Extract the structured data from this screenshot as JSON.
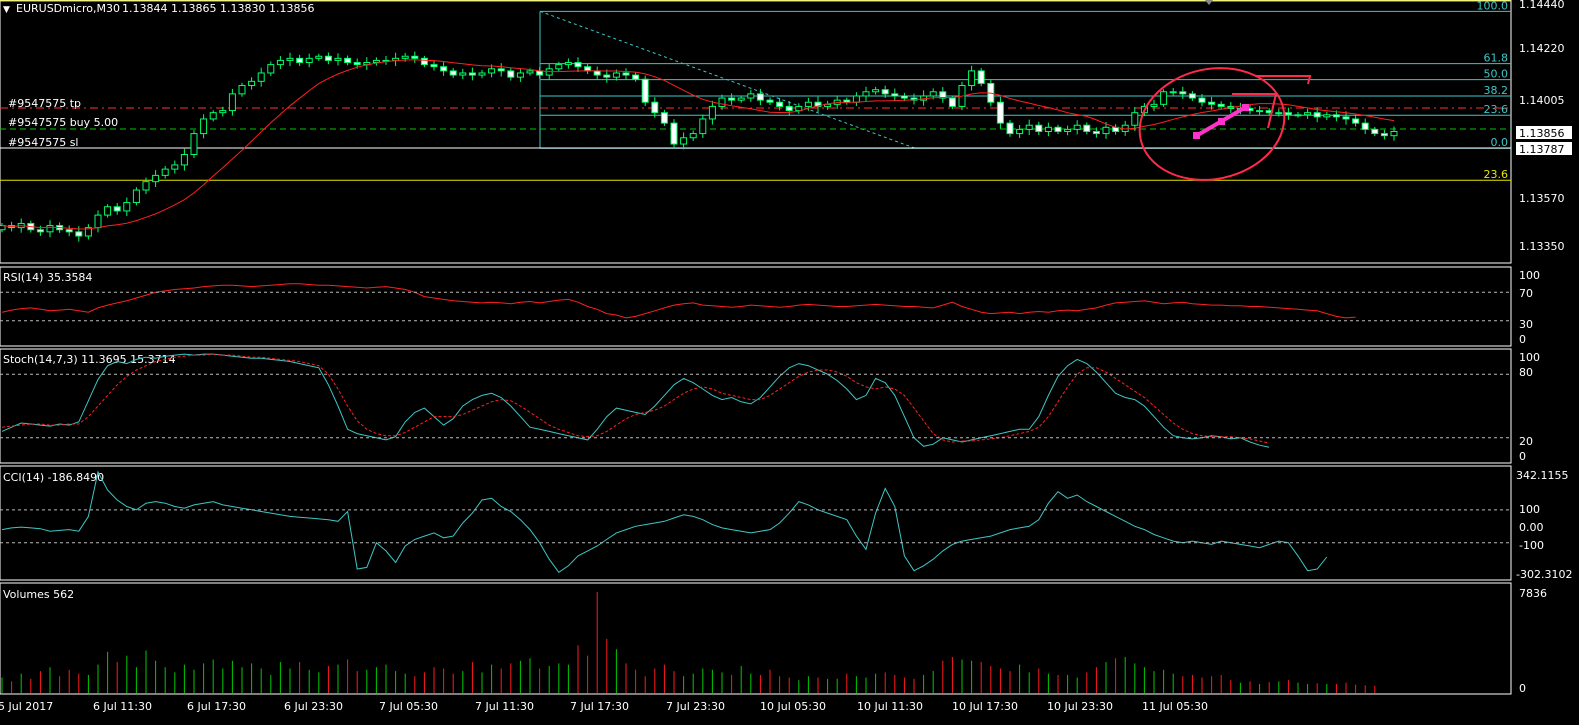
{
  "colors": {
    "bg": "#000000",
    "frame": "#ffffff",
    "bull": "#00ff66",
    "bear": "#ffffff",
    "ma": "#ff2020",
    "rsi": "#ff2020",
    "stoch_main": "#3ec6c6",
    "stoch_signal": "#ff2020",
    "cci": "#3ec6c6",
    "vol_up": "#00c800",
    "vol_down": "#ff1a1a",
    "fibo_up": "#3ec6c6",
    "fibo_down": "#e6e600",
    "tp_line": "#ff3030",
    "entry_line": "#00c800",
    "sl_line": "#ffffff",
    "annotation": "#ff2a4a",
    "arrow": "#ff33cc"
  },
  "header": {
    "symbol": "EURUSDmicro,M30",
    "ohlc": "1.13844 1.13865 1.13830 1.13856"
  },
  "order_labels": {
    "tp": "#9547575 tp",
    "buy": "#9547575 buy 5.00",
    "sl": "#9547575 sl"
  },
  "price_axis": {
    "ticks": [
      "1.14440",
      "1.14220",
      "1.14005",
      "1.13570",
      "1.13350"
    ],
    "tick_values": [
      1.1444,
      1.1422,
      1.14005,
      1.1357,
      1.1335
    ],
    "current_price": "1.13856",
    "sl_price": "1.13787",
    "range": [
      1.1325,
      1.1447
    ]
  },
  "fibo_retracement": {
    "levels": [
      {
        "label": "100.0",
        "price": 1.14435,
        "color": "up"
      },
      {
        "label": "61.8",
        "price": 1.14185,
        "color": "up"
      },
      {
        "label": "50.0",
        "price": 1.14108,
        "color": "up"
      },
      {
        "label": "38.2",
        "price": 1.1403,
        "color": "up"
      },
      {
        "label": "23.6",
        "price": 1.13938,
        "color": "up"
      },
      {
        "label": "0.0",
        "price": 1.1378,
        "color": "up"
      },
      {
        "label": "23.6",
        "price": 1.13627,
        "color": "down"
      }
    ]
  },
  "indicators": {
    "rsi": {
      "label": "RSI(14) 35.3584",
      "ticks": [
        "100",
        "70",
        "30",
        "0"
      ],
      "tick_values": [
        100,
        70,
        30,
        0
      ]
    },
    "stoch": {
      "label": "Stoch(14,7,3) 11.3695 15.3714",
      "ticks": [
        "100",
        "80",
        "20",
        "0"
      ],
      "tick_values": [
        100,
        80,
        20,
        0
      ]
    },
    "cci": {
      "label": "CCI(14) -186.8490",
      "ticks": [
        "342.1155",
        "100",
        "0.00",
        "-100",
        "-302.3102"
      ],
      "tick_values": [
        342.1155,
        100,
        0,
        -100,
        -302.3102
      ]
    },
    "volumes": {
      "label": "Volumes 562",
      "ticks": [
        "7836",
        "0"
      ],
      "tick_values": [
        7836,
        0
      ]
    }
  },
  "time_axis": {
    "labels": [
      "5 Jul 2017",
      "6 Jul 11:30",
      "6 Jul 17:30",
      "6 Jul 23:30",
      "7 Jul 05:30",
      "7 Jul 11:30",
      "7 Jul 17:30",
      "7 Jul 23:30",
      "10 Jul 05:30",
      "10 Jul 11:30",
      "10 Jul 17:30",
      "10 Jul 23:30",
      "11 Jul 05:30"
    ],
    "label_bar_index": [
      0,
      12,
      24,
      36,
      48,
      60,
      72,
      84,
      96,
      108,
      120,
      132,
      144
    ]
  },
  "chart_data": [
    {
      "type": "candlestick",
      "title": "EURUSDmicro,M30",
      "x_unit": "30-minute bars",
      "closes": [
        1.1341,
        1.134,
        1.1342,
        1.1339,
        1.1338,
        1.1341,
        1.1339,
        1.1338,
        1.1336,
        1.134,
        1.1346,
        1.135,
        1.1348,
        1.1352,
        1.1358,
        1.1362,
        1.1365,
        1.1368,
        1.137,
        1.1375,
        1.1385,
        1.1392,
        1.1395,
        1.1396,
        1.1404,
        1.1408,
        1.141,
        1.1414,
        1.1418,
        1.142,
        1.1421,
        1.1419,
        1.1421,
        1.1422,
        1.142,
        1.1421,
        1.1419,
        1.1418,
        1.1419,
        1.142,
        1.142,
        1.1421,
        1.1422,
        1.1421,
        1.1418,
        1.1417,
        1.1415,
        1.1413,
        1.1414,
        1.1413,
        1.1414,
        1.1416,
        1.1415,
        1.1412,
        1.1414,
        1.1415,
        1.1413,
        1.1416,
        1.1418,
        1.1419,
        1.1417,
        1.1415,
        1.1413,
        1.1412,
        1.1414,
        1.1413,
        1.1411,
        1.14,
        1.1395,
        1.139,
        1.138,
        1.1383,
        1.1385,
        1.1392,
        1.1398,
        1.1402,
        1.1401,
        1.1402,
        1.1404,
        1.1401,
        1.14,
        1.1398,
        1.1396,
        1.1398,
        1.14,
        1.1398,
        1.1399,
        1.1401,
        1.14,
        1.1403,
        1.1405,
        1.1406,
        1.1404,
        1.1403,
        1.1402,
        1.1401,
        1.1403,
        1.1405,
        1.1402,
        1.1398,
        1.1408,
        1.1415,
        1.1409,
        1.14,
        1.139,
        1.1385,
        1.1387,
        1.1389,
        1.1386,
        1.1388,
        1.1386,
        1.1387,
        1.1389,
        1.1386,
        1.1385,
        1.1388,
        1.1386,
        1.1389,
        1.1395,
        1.1398,
        1.1399,
        1.1405,
        1.1405,
        1.1404,
        1.1402,
        1.14,
        1.1399,
        1.1398,
        1.1397,
        1.1397,
        1.1396,
        1.1396,
        1.1395,
        1.1395,
        1.1394,
        1.1394,
        1.1395,
        1.1393,
        1.1394,
        1.1393,
        1.1392,
        1.139,
        1.1387,
        1.1385,
        1.1384,
        1.1386
      ],
      "ma_period": 14,
      "price_range": [
        1.1325,
        1.1447
      ]
    },
    {
      "type": "line",
      "name": "RSI(14)",
      "ylim": [
        0,
        100
      ],
      "values": [
        42,
        45,
        47,
        48,
        46,
        44,
        45,
        46,
        44,
        42,
        48,
        52,
        55,
        58,
        62,
        66,
        70,
        72,
        74,
        75,
        76,
        78,
        79,
        80,
        80,
        79,
        78,
        79,
        80,
        81,
        82,
        82,
        81,
        80,
        80,
        79,
        78,
        77,
        76,
        77,
        78,
        76,
        74,
        70,
        64,
        62,
        60,
        58,
        57,
        56,
        55,
        56,
        55,
        54,
        56,
        57,
        55,
        57,
        59,
        60,
        56,
        50,
        46,
        40,
        38,
        34,
        36,
        40,
        44,
        48,
        52,
        54,
        55,
        52,
        51,
        50,
        49,
        50,
        52,
        51,
        50,
        49,
        50,
        52,
        53,
        52,
        51,
        50,
        50,
        51,
        52,
        53,
        52,
        51,
        50,
        50,
        49,
        48,
        52,
        56,
        50,
        46,
        42,
        40,
        41,
        42,
        40,
        42,
        43,
        42,
        44,
        45,
        44,
        46,
        48,
        52,
        55,
        56,
        57,
        58,
        56,
        54,
        55,
        56,
        54,
        53,
        52,
        52,
        51,
        51,
        50,
        50,
        49,
        48,
        47,
        46,
        45,
        44,
        40,
        36,
        34,
        35
      ]
    },
    {
      "type": "line",
      "name": "Stoch main",
      "ylim": [
        0,
        100
      ],
      "values": [
        26,
        30,
        34,
        33,
        32,
        31,
        33,
        32,
        35,
        55,
        75,
        88,
        92,
        90,
        94,
        96,
        95,
        97,
        98,
        99,
        98,
        99,
        99,
        98,
        97,
        96,
        95,
        95,
        94,
        93,
        92,
        90,
        88,
        86,
        70,
        50,
        28,
        24,
        22,
        20,
        18,
        21,
        35,
        44,
        48,
        40,
        32,
        38,
        50,
        56,
        60,
        62,
        58,
        50,
        40,
        30,
        28,
        26,
        24,
        22,
        20,
        18,
        28,
        40,
        48,
        46,
        44,
        42,
        50,
        60,
        70,
        76,
        72,
        66,
        60,
        56,
        58,
        54,
        52,
        58,
        68,
        78,
        86,
        90,
        88,
        84,
        80,
        74,
        66,
        56,
        60,
        76,
        72,
        60,
        40,
        20,
        12,
        14,
        20,
        18,
        16,
        18,
        20,
        22,
        24,
        26,
        28,
        28,
        40,
        60,
        78,
        88,
        94,
        90,
        82,
        72,
        62,
        58,
        56,
        50,
        40,
        30,
        22,
        20,
        19,
        20,
        22,
        21,
        19,
        20,
        16,
        13,
        11
      ]
    },
    {
      "type": "line",
      "name": "Stoch signal",
      "ylim": [
        0,
        100
      ],
      "values": [
        30,
        31,
        32,
        33,
        33,
        32,
        32,
        33,
        33,
        40,
        50,
        60,
        70,
        78,
        84,
        88,
        92,
        94,
        96,
        97,
        98,
        98,
        99,
        98,
        98,
        97,
        96,
        96,
        95,
        94,
        93,
        92,
        90,
        88,
        80,
        66,
        50,
        36,
        28,
        24,
        22,
        22,
        25,
        30,
        35,
        40,
        40,
        40,
        42,
        46,
        50,
        54,
        56,
        55,
        50,
        44,
        38,
        32,
        28,
        25,
        22,
        21,
        22,
        26,
        32,
        38,
        42,
        44,
        46,
        50,
        56,
        62,
        66,
        68,
        66,
        62,
        60,
        58,
        56,
        56,
        60,
        66,
        72,
        78,
        82,
        84,
        84,
        82,
        78,
        72,
        68,
        66,
        68,
        66,
        60,
        48,
        36,
        24,
        18,
        16,
        17,
        17,
        18,
        19,
        20,
        22,
        24,
        26,
        30,
        40,
        54,
        68,
        80,
        86,
        86,
        82,
        76,
        70,
        64,
        58,
        50,
        42,
        34,
        28,
        24,
        22,
        21,
        21,
        21,
        20,
        19,
        17,
        15
      ]
    },
    {
      "type": "line",
      "name": "CCI(14)",
      "ylim": [
        -302.3102,
        342.1155
      ],
      "values": [
        -20,
        -10,
        -5,
        -10,
        -15,
        -30,
        -25,
        -20,
        -30,
        60,
        330,
        220,
        160,
        120,
        100,
        140,
        150,
        140,
        120,
        110,
        130,
        140,
        150,
        130,
        120,
        110,
        100,
        90,
        80,
        70,
        60,
        55,
        50,
        45,
        40,
        30,
        90,
        -260,
        -250,
        -100,
        -150,
        -220,
        -120,
        -80,
        -60,
        -40,
        -70,
        -60,
        20,
        80,
        160,
        170,
        120,
        90,
        40,
        -20,
        -100,
        -200,
        -280,
        -240,
        -180,
        -150,
        -120,
        -80,
        -40,
        -20,
        0,
        10,
        20,
        30,
        50,
        70,
        60,
        40,
        10,
        -10,
        -20,
        -30,
        -40,
        -30,
        -20,
        20,
        80,
        150,
        130,
        100,
        80,
        60,
        40,
        -60,
        -140,
        80,
        230,
        120,
        -180,
        -270,
        -240,
        -200,
        -150,
        -110,
        -90,
        -80,
        -70,
        -60,
        -40,
        -20,
        -10,
        0,
        40,
        140,
        210,
        170,
        190,
        150,
        120,
        90,
        60,
        30,
        0,
        -20,
        -50,
        -70,
        -90,
        -100,
        -90,
        -100,
        -110,
        -90,
        -100,
        -110,
        -120,
        -130,
        -110,
        -90,
        -100,
        -180,
        -270,
        -260,
        -187
      ]
    },
    {
      "type": "bar",
      "name": "Volumes",
      "ylim": [
        0,
        7836
      ],
      "values": [
        1200,
        900,
        1500,
        1100,
        1700,
        2000,
        1300,
        1800,
        1500,
        1400,
        2200,
        3200,
        2400,
        2900,
        2000,
        3300,
        2500,
        2000,
        1600,
        2200,
        1800,
        2300,
        2600,
        1900,
        2500,
        2000,
        2300,
        1900,
        1400,
        2400,
        1900,
        2400,
        1800,
        1600,
        2100,
        2200,
        2600,
        1700,
        1800,
        2000,
        2200,
        1700,
        1500,
        1300,
        1600,
        2000,
        1900,
        1500,
        1700,
        2400,
        1600,
        2200,
        1900,
        2300,
        2500,
        2700,
        1900,
        2100,
        2300,
        2200,
        3700,
        2900,
        7836,
        4200,
        3400,
        2300,
        1800,
        1300,
        1900,
        2200,
        1700,
        1300,
        1500,
        1900,
        1800,
        1600,
        1400,
        2100,
        1500,
        1400,
        1800,
        1300,
        1200,
        1000,
        1300,
        1200,
        1100,
        1100,
        1500,
        1300,
        1200,
        1500,
        1600,
        1400,
        1200,
        1100,
        1400,
        1700,
        2500,
        2800,
        2600,
        2500,
        2400,
        2100,
        1900,
        1700,
        2200,
        1600,
        1900,
        1500,
        1400,
        1400,
        1200,
        1600,
        2000,
        2400,
        2700,
        2800,
        2300,
        2000,
        1700,
        1800,
        1500,
        1300,
        1400,
        1200,
        1300,
        1400,
        1000,
        800,
        900,
        700,
        850,
        900,
        1000,
        800,
        700,
        750,
        700,
        700,
        800,
        650,
        600,
        562
      ]
    }
  ]
}
